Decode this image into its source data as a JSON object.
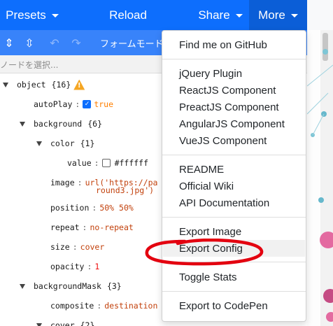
{
  "topbar": {
    "presets": "Presets",
    "reload": "Reload",
    "share": "Share",
    "more": "More",
    "accent_color": "#0d6efd"
  },
  "editor": {
    "mode_label": "フォームモード",
    "search_placeholder": "ノードを選択...",
    "toolbar_icons": [
      "expand-all-icon",
      "collapse-all-icon",
      "undo-icon",
      "redo-icon"
    ]
  },
  "tree": {
    "object": {
      "key": "object",
      "count": "{16}"
    },
    "autoPlay": {
      "key": "autoPlay",
      "value": "true"
    },
    "background": {
      "key": "background",
      "count": "{6}"
    },
    "color": {
      "key": "color",
      "count": "{1}"
    },
    "value": {
      "key": "value",
      "value": "#ffffff"
    },
    "image": {
      "key": "image",
      "value_line1": "url('https://pa",
      "value_line2": "round3.jpg')"
    },
    "position": {
      "key": "position",
      "value": "50% 50%"
    },
    "repeat": {
      "key": "repeat",
      "value": "no-repeat"
    },
    "size": {
      "key": "size",
      "value": "cover"
    },
    "opacity": {
      "key": "opacity",
      "value": "1"
    },
    "backgroundMask": {
      "key": "backgroundMask",
      "count": "{3}"
    },
    "composite": {
      "key": "composite",
      "value": "destination"
    },
    "cover": {
      "key": "cover",
      "count": "{2}"
    }
  },
  "menu": {
    "items": [
      "Find me on GitHub",
      "jQuery Plugin",
      "ReactJS Component",
      "PreactJS Component",
      "AngularJS Component",
      "VueJS Component",
      "README",
      "Official Wiki",
      "API Documentation",
      "Export Image",
      "Export Config",
      "Toggle Stats",
      "Export to CodePen"
    ],
    "highlighted": "Export Config",
    "annotation_color": "#e3000f"
  }
}
